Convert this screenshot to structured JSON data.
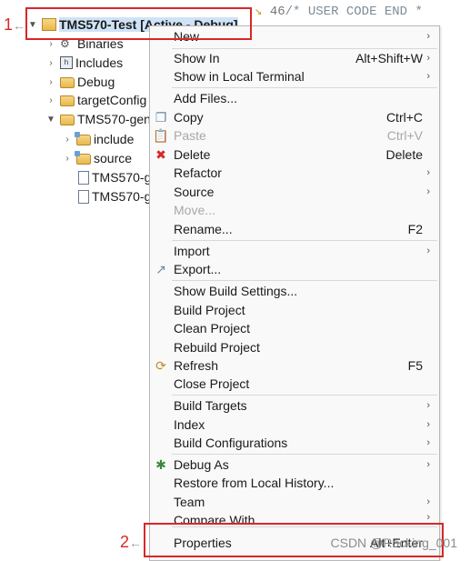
{
  "tree": {
    "root_label": "TMS570-Test  [Active - Debug]",
    "items": [
      {
        "label": "Binaries"
      },
      {
        "label": "Includes"
      },
      {
        "label": "Debug"
      },
      {
        "label": "targetConfig"
      },
      {
        "label": "TMS570-gen"
      },
      {
        "label": "include"
      },
      {
        "label": "source"
      },
      {
        "label": "TMS570-g"
      },
      {
        "label": "TMS570-g"
      }
    ]
  },
  "editor": {
    "line_number": "46",
    "code": "/* USER CODE END *"
  },
  "annotations": {
    "marker1": "1",
    "marker2": "2",
    "arrow": "←"
  },
  "menu": {
    "new": "New",
    "show_in": "Show In",
    "show_in_sc": "Alt+Shift+W",
    "show_local_terminal": "Show in Local Terminal",
    "add_files": "Add Files...",
    "copy": "Copy",
    "copy_sc": "Ctrl+C",
    "paste": "Paste",
    "paste_sc": "Ctrl+V",
    "delete": "Delete",
    "delete_sc": "Delete",
    "refactor": "Refactor",
    "source": "Source",
    "move": "Move...",
    "rename": "Rename...",
    "rename_sc": "F2",
    "import": "Import",
    "export": "Export...",
    "show_build_settings": "Show Build Settings...",
    "build_project": "Build Project",
    "clean_project": "Clean Project",
    "rebuild_project": "Rebuild Project",
    "refresh": "Refresh",
    "refresh_sc": "F5",
    "close_project": "Close Project",
    "build_targets": "Build Targets",
    "index": "Index",
    "build_configurations": "Build Configurations",
    "debug_as": "Debug As",
    "restore_history": "Restore from Local History...",
    "team": "Team",
    "compare_with": "Compare With",
    "properties": "Properties",
    "properties_sc": "Alt+Enter"
  },
  "watermark": "CSDN @Rocking_001",
  "colors": {
    "highlight": "#d62828",
    "menu_bg": "#f9f9f9",
    "disabled": "#a8a8a8"
  }
}
